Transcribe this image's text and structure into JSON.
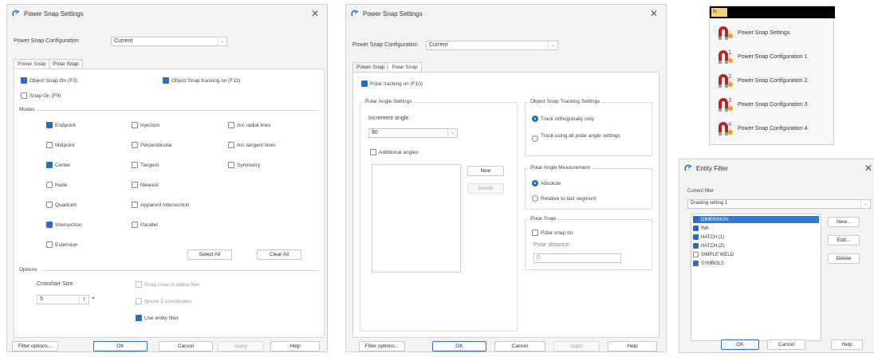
{
  "dialog1": {
    "title": "Power Snap Settings",
    "config_label": "Power Snap Configuration",
    "config_value": "Current",
    "tabs": [
      "Power Snap",
      "Polar Snap"
    ],
    "object_snap_on": "Object Snap On (F3)",
    "object_snap_tracking": "Object Snap tracking on (F11)",
    "snap_on": "Snap On (F9)",
    "modes_title": "Modes",
    "modes": [
      {
        "label": "Endpoint",
        "checked": true
      },
      {
        "label": "Injection",
        "checked": false
      },
      {
        "label": "Arc radial lines",
        "checked": false
      },
      {
        "label": "Midpoint",
        "checked": false
      },
      {
        "label": "Perpendicular",
        "checked": false
      },
      {
        "label": "Arc tangent lines",
        "checked": false
      },
      {
        "label": "Center",
        "checked": true
      },
      {
        "label": "Tangent",
        "checked": false
      },
      {
        "label": "Symmetry",
        "checked": false
      },
      {
        "label": "Node",
        "checked": false
      },
      {
        "label": "Nearest",
        "checked": false
      },
      {
        "label": "Quadrant",
        "checked": false
      },
      {
        "label": "Apparent intersection",
        "checked": false
      },
      {
        "label": "Intersection",
        "checked": true
      },
      {
        "label": "Parallel",
        "checked": false
      },
      {
        "label": "Extension",
        "checked": false
      }
    ],
    "select_all": "Select All",
    "clear_all": "Clear All",
    "options_title": "Options",
    "crosshair_label": "Crosshair Size",
    "crosshair_value": "5",
    "snap_in_status": "Snap snap in status line",
    "ignore_z": "Ignore Z coordinates",
    "use_entity_filter": "Use entity filter",
    "buttons": {
      "filter": "Filter options...",
      "ok": "OK",
      "cancel": "Cancel",
      "apply": "Apply",
      "help": "Help"
    }
  },
  "dialog2": {
    "title": "Power Snap Settings",
    "config_label": "Power Snap Configuration",
    "config_value": "Current",
    "tabs": [
      "Power Snap",
      "Polar Snap"
    ],
    "polar_tracking": "Polar tracking on (F10)",
    "polar_angle_title": "Polar Angle Settings",
    "increment_label": "Increment angle:",
    "increment_value": "90",
    "additional_angles": "Additional angles",
    "new_btn": "New",
    "delete_btn": "Delete",
    "tracking_title": "Object Snap Tracking Settings",
    "track_ortho": "Track orthogonally only",
    "track_polar": "Track using all polar angle settings",
    "measurement_title": "Polar Angle Measurement",
    "absolute": "Absolute",
    "relative": "Relative to last segment",
    "polar_snap_title": "Polar Snap",
    "polar_snap_on": "Polar snap on",
    "polar_distance_label": "Polar distance:",
    "polar_distance_value": "0",
    "buttons": {
      "filter": "Filter options...",
      "ok": "OK",
      "cancel": "Cancel",
      "apply": "Apply",
      "help": "Help"
    }
  },
  "menu": {
    "top_label": "fx",
    "items": [
      {
        "label": "Power Snap Settings",
        "num": ""
      },
      {
        "label": "Power Snap Configuration 1",
        "num": "1"
      },
      {
        "label": "Power Snap Configuration 2",
        "num": "2"
      },
      {
        "label": "Power Snap Configuration 3",
        "num": "3"
      },
      {
        "label": "Power Snap Configuration 4",
        "num": "4"
      }
    ]
  },
  "entity_filter": {
    "title": "Entity Filter",
    "current_filter_label": "Current filter",
    "current_filter_value": "Drawing setting 1",
    "items": [
      {
        "label": "DIMENSION",
        "checked": true,
        "selected": true
      },
      {
        "label": "INK",
        "checked": true,
        "selected": false
      },
      {
        "label": "HATCH (1)",
        "checked": true,
        "selected": false
      },
      {
        "label": "HATCH (2)",
        "checked": true,
        "selected": false
      },
      {
        "label": "SIMPLE WELD",
        "checked": false,
        "selected": false
      },
      {
        "label": "SYMBOLS",
        "checked": true,
        "selected": false
      }
    ],
    "new_btn": "New...",
    "edit_btn": "Edit...",
    "delete_btn": "Delete",
    "ok": "OK",
    "cancel": "Cancel",
    "help": "Help"
  },
  "colors": {
    "accent": "#2a6ac9",
    "magnet_red": "#b8261f",
    "magnet_gold": "#e3a22a"
  }
}
